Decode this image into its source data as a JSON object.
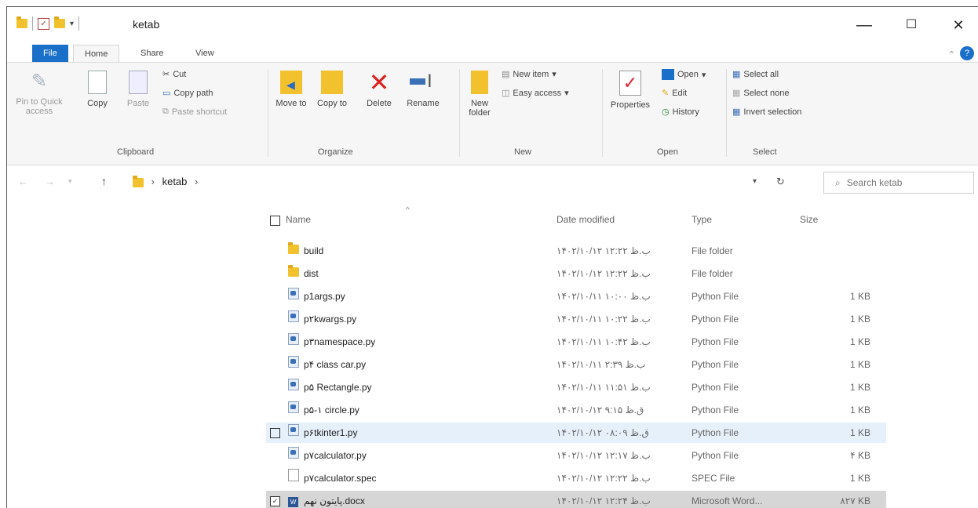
{
  "window": {
    "title": "ketab"
  },
  "tabs": [
    "File",
    "Home",
    "Share",
    "View"
  ],
  "ribbon": {
    "clipboard": {
      "label": "Clipboard",
      "pin": "Pin to Quick access",
      "copy": "Copy",
      "paste": "Paste",
      "cut": "Cut",
      "copy_path": "Copy path",
      "paste_shortcut": "Paste shortcut"
    },
    "organize": {
      "label": "Organize",
      "move_to": "Move to",
      "copy_to": "Copy to",
      "delete": "Delete",
      "rename": "Rename"
    },
    "new": {
      "label": "New",
      "new_item": "New item",
      "easy_access": "Easy access",
      "new_folder": "New folder"
    },
    "open": {
      "label": "Open",
      "properties": "Properties",
      "open": "Open",
      "edit": "Edit",
      "history": "History"
    },
    "select": {
      "label": "Select",
      "select_all": "Select all",
      "select_none": "Select none",
      "invert": "Invert selection"
    }
  },
  "address": {
    "path": "ketab",
    "search_placeholder": "Search ketab"
  },
  "columns": {
    "name": "Name",
    "date": "Date modified",
    "type": "Type",
    "size": "Size"
  },
  "files": [
    {
      "name": "build",
      "date": "۱۴۰۲/۱۰/۱۲ ب.ظ ۱۲:۲۲",
      "type": "File folder",
      "size": "",
      "icon": "folder-icon"
    },
    {
      "name": "dist",
      "date": "۱۴۰۲/۱۰/۱۲ ب.ظ ۱۲:۲۲",
      "type": "File folder",
      "size": "",
      "icon": "folder-icon"
    },
    {
      "name": "p1args.py",
      "date": "۱۴۰۲/۱۰/۱۱ ب.ظ ۱۰:۰۰",
      "type": "Python File",
      "size": "1 KB",
      "icon": "python-file-icon"
    },
    {
      "name": "p۲kwargs.py",
      "date": "۱۴۰۲/۱۰/۱۱ ب.ظ ۱۰:۲۲",
      "type": "Python File",
      "size": "1 KB",
      "icon": "python-file-icon"
    },
    {
      "name": "p۳namespace.py",
      "date": "۱۴۰۲/۱۰/۱۱ ب.ظ ۱۰:۴۲",
      "type": "Python File",
      "size": "1 KB",
      "icon": "python-file-icon"
    },
    {
      "name": "p۴ class car.py",
      "date": "۱۴۰۲/۱۰/۱۱ ب.ظ ۲:۳۹",
      "type": "Python File",
      "size": "1 KB",
      "icon": "python-file-icon"
    },
    {
      "name": "p۵ Rectangle.py",
      "date": "۱۴۰۲/۱۰/۱۱ ب.ظ ۱۱:۵۱",
      "type": "Python File",
      "size": "1 KB",
      "icon": "python-file-icon"
    },
    {
      "name": "p۵-۱ circle.py",
      "date": "۱۴۰۲/۱۰/۱۲ ق.ظ ۹:۱۵",
      "type": "Python File",
      "size": "1 KB",
      "icon": "python-file-icon"
    },
    {
      "name": "p۶tkinter1.py",
      "date": "۱۴۰۲/۱۰/۱۲ ق.ظ ۰۸:۰۹",
      "type": "Python File",
      "size": "1 KB",
      "icon": "python-file-icon"
    },
    {
      "name": "p۷calculator.py",
      "date": "۱۴۰۲/۱۰/۱۲ ب.ظ ۱۲:۱۷",
      "type": "Python File",
      "size": "۴ KB",
      "icon": "python-file-icon"
    },
    {
      "name": "p۷calculator.spec",
      "date": "۱۴۰۲/۱۰/۱۲ ب.ظ ۱۲:۲۲",
      "type": "SPEC File",
      "size": "1 KB",
      "icon": "file-icon"
    },
    {
      "name": "پایتون نهم.docx",
      "date": "۱۴۰۲/۱۰/۱۲ ب.ظ ۱۲:۲۴",
      "type": "Microsoft Word...",
      "size": "۸۲۷ KB",
      "icon": "word-file-icon"
    }
  ],
  "colors": {
    "accent": "#1a6fc9",
    "folder": "#f2c12e",
    "delete": "#e02020",
    "selected_row": "#d6d6d6",
    "hover_row": "#e6f0fb"
  }
}
